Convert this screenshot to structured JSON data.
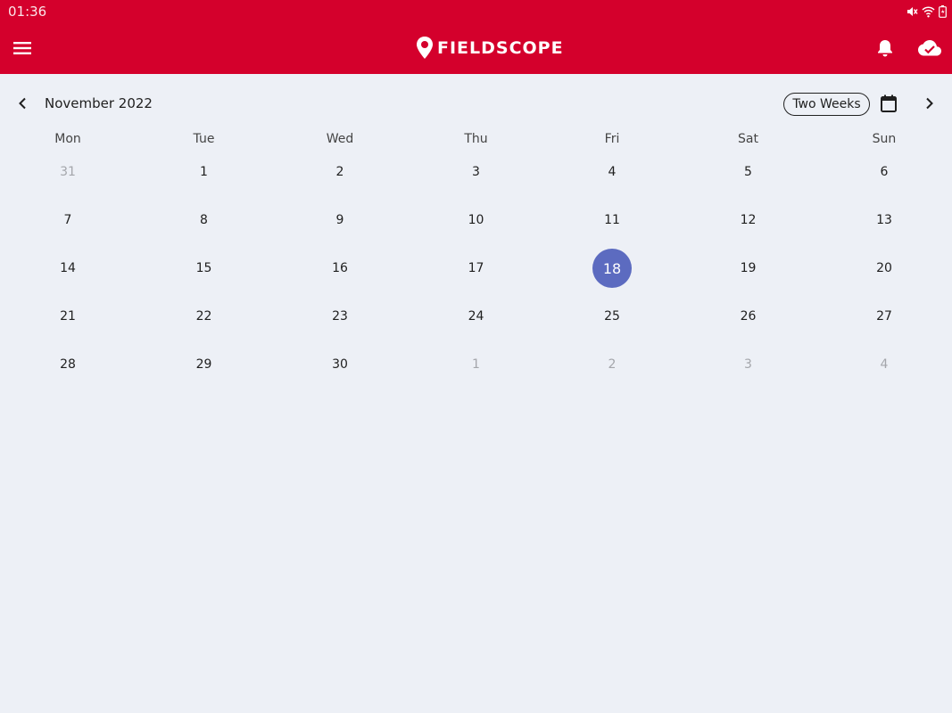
{
  "status_bar": {
    "time": "01:36"
  },
  "app_bar": {
    "logo_text": "FIELDSCOPE",
    "colors": {
      "brand": "#d4002c",
      "accent": "#5c6bc0"
    },
    "icons": {
      "menu": "menu-icon",
      "bell": "bell-icon",
      "cloud": "cloud-check-icon"
    }
  },
  "calendar": {
    "month_label": "November 2022",
    "range_button": "Two Weeks",
    "weekdays": [
      "Mon",
      "Tue",
      "Wed",
      "Thu",
      "Fri",
      "Sat",
      "Sun"
    ],
    "weeks": [
      [
        {
          "d": "31",
          "muted": true
        },
        {
          "d": "1"
        },
        {
          "d": "2"
        },
        {
          "d": "3"
        },
        {
          "d": "4"
        },
        {
          "d": "5"
        },
        {
          "d": "6"
        }
      ],
      [
        {
          "d": "7"
        },
        {
          "d": "8"
        },
        {
          "d": "9"
        },
        {
          "d": "10"
        },
        {
          "d": "11"
        },
        {
          "d": "12"
        },
        {
          "d": "13"
        }
      ],
      [
        {
          "d": "14"
        },
        {
          "d": "15"
        },
        {
          "d": "16"
        },
        {
          "d": "17"
        },
        {
          "d": "18",
          "selected": true
        },
        {
          "d": "19"
        },
        {
          "d": "20"
        }
      ],
      [
        {
          "d": "21"
        },
        {
          "d": "22"
        },
        {
          "d": "23"
        },
        {
          "d": "24"
        },
        {
          "d": "25"
        },
        {
          "d": "26"
        },
        {
          "d": "27"
        }
      ],
      [
        {
          "d": "28"
        },
        {
          "d": "29"
        },
        {
          "d": "30"
        },
        {
          "d": "1",
          "muted": true
        },
        {
          "d": "2",
          "muted": true
        },
        {
          "d": "3",
          "muted": true
        },
        {
          "d": "4",
          "muted": true
        }
      ]
    ]
  }
}
